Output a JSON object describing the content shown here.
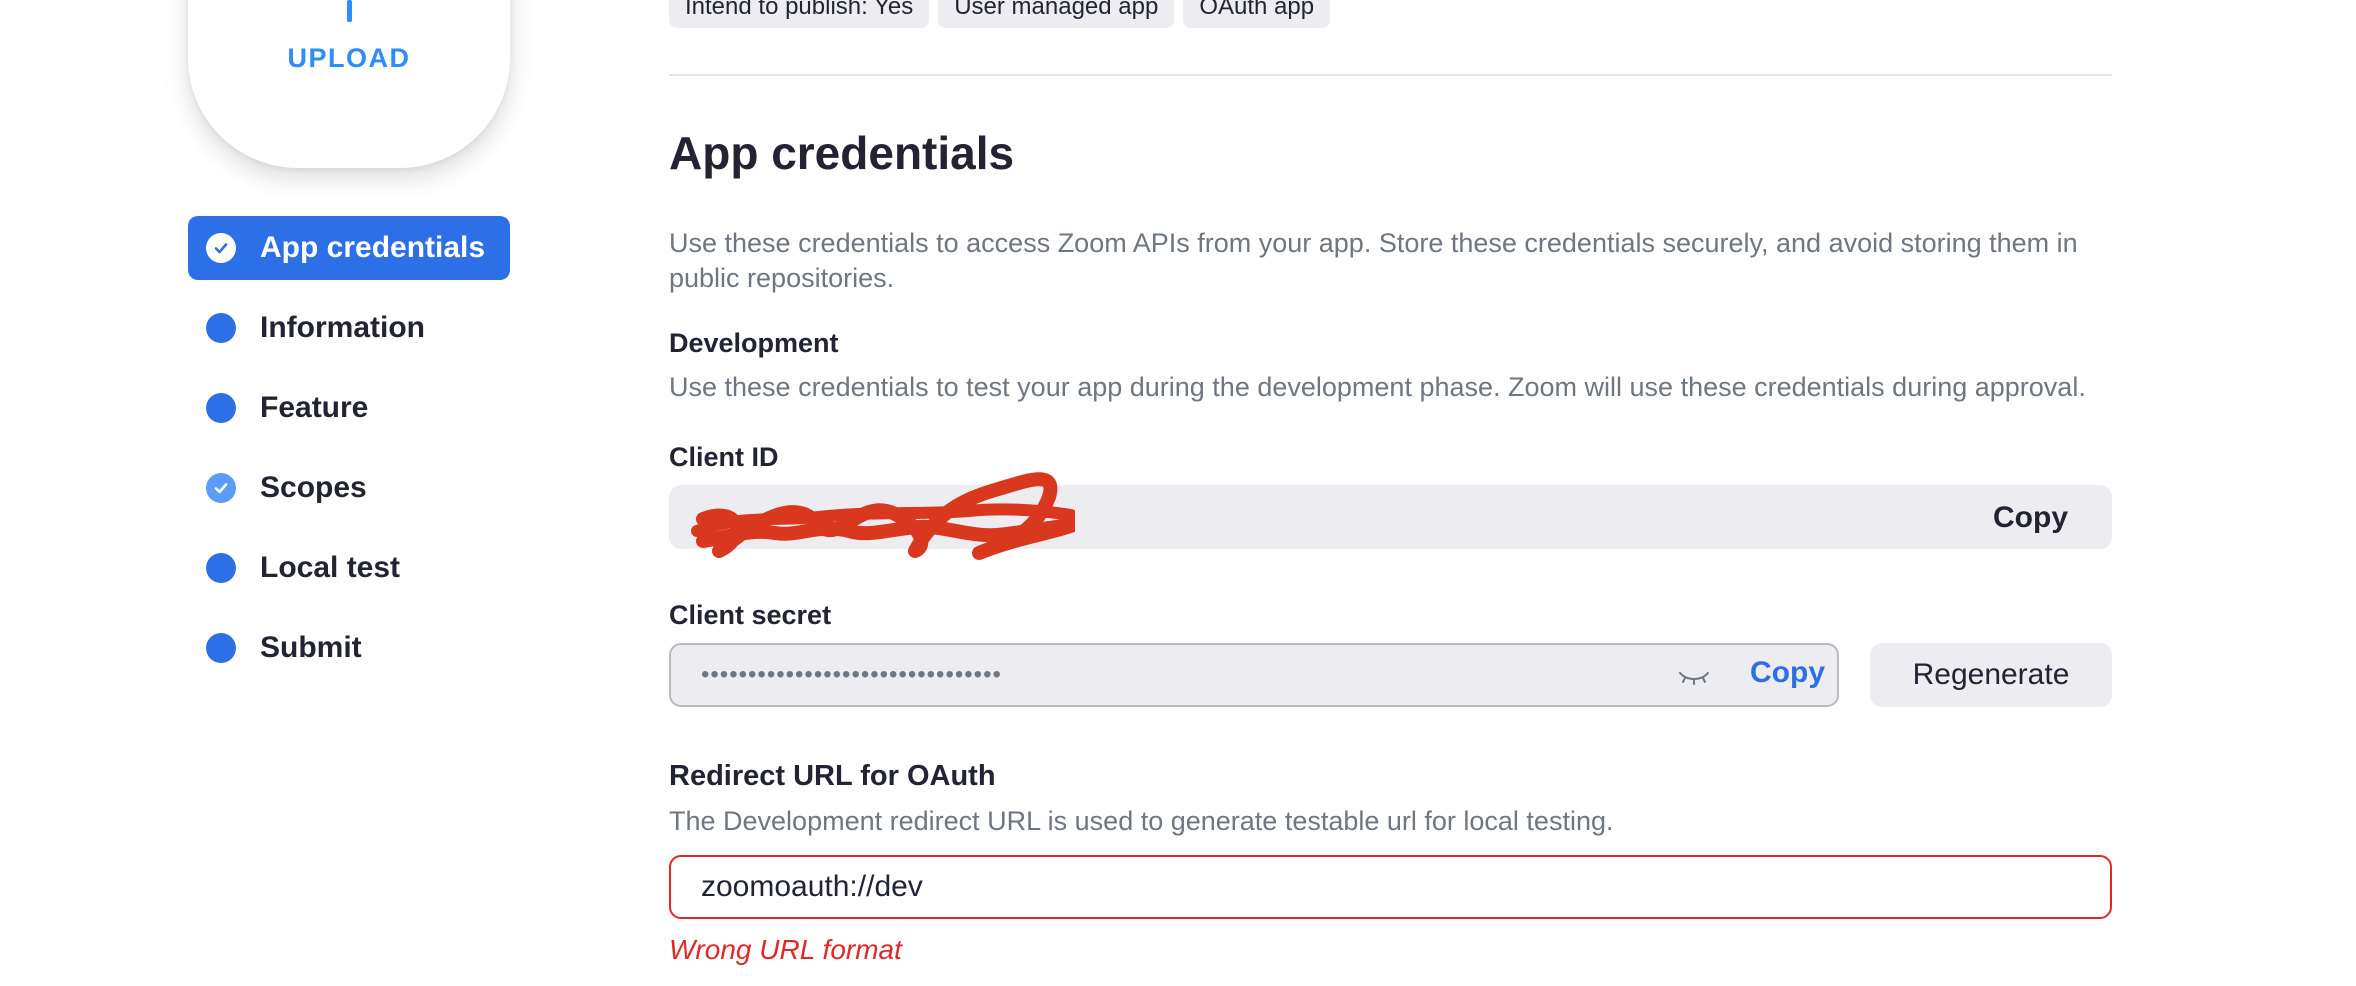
{
  "upload": {
    "label": "UPLOAD"
  },
  "sidebar": {
    "items": [
      {
        "label": "App credentials",
        "state": "active"
      },
      {
        "label": "Information",
        "state": "pending"
      },
      {
        "label": "Feature",
        "state": "pending"
      },
      {
        "label": "Scopes",
        "state": "done"
      },
      {
        "label": "Local test",
        "state": "pending"
      },
      {
        "label": "Submit",
        "state": "pending"
      }
    ]
  },
  "tags": [
    "Intend to publish: Yes",
    "User managed app",
    "OAuth app"
  ],
  "main": {
    "title": "App credentials",
    "intro": "Use these credentials to access Zoom APIs from your app. Store these credentials securely, and avoid storing them in public repositories.",
    "development": {
      "title": "Development",
      "description": "Use these credentials to test your app during the development phase. Zoom will use these credentials during approval."
    },
    "client_id": {
      "label": "Client ID",
      "value": "",
      "copy_label": "Copy"
    },
    "client_secret": {
      "label": "Client secret",
      "value": "••••••••••••••••••••••••••••••••",
      "copy_label": "Copy",
      "regenerate_label": "Regenerate"
    },
    "redirect": {
      "label": "Redirect URL for OAuth",
      "description": "The Development redirect URL is used to generate testable url for local testing.",
      "value": "zoomoauth://dev",
      "error": "Wrong URL format"
    }
  },
  "colors": {
    "accent": "#2d6fe6",
    "error": "#e02828",
    "redaction": "#d9381e"
  }
}
